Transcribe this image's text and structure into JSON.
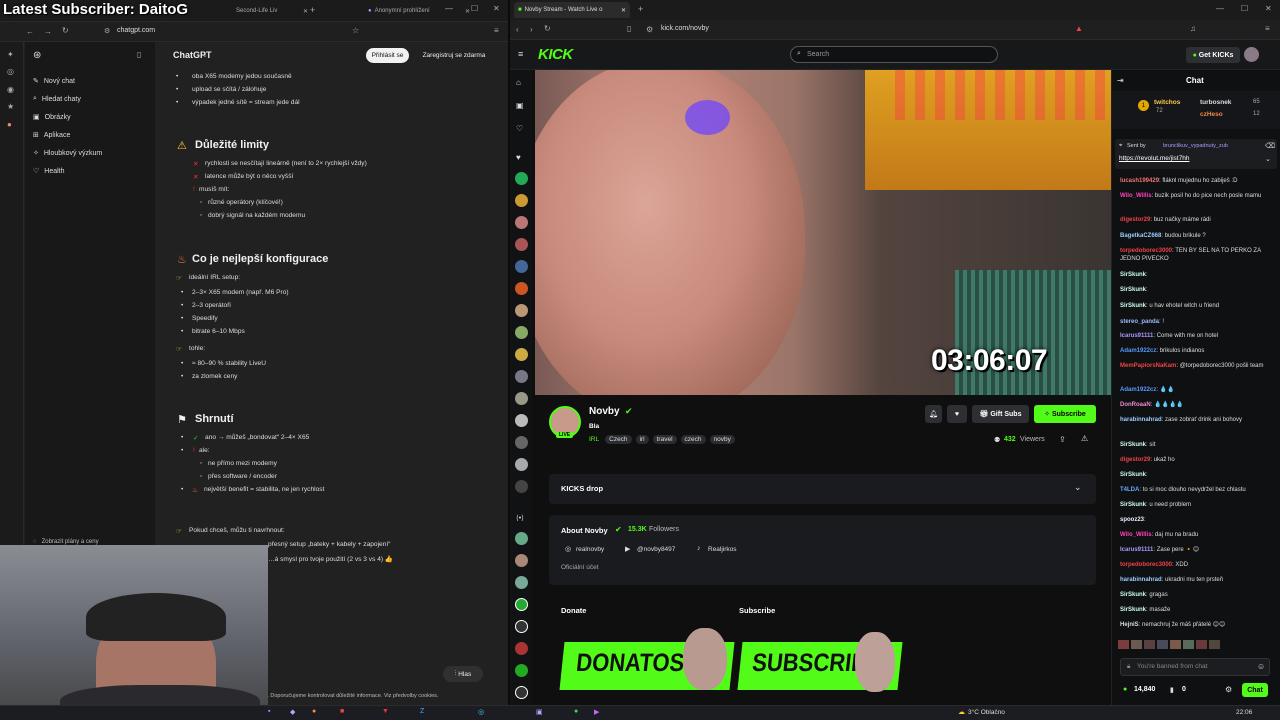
{
  "overlay": {
    "title": "Latest Subscriber: DaitoG"
  },
  "left_browser": {
    "tabs": [
      {
        "label": "Second-Life Liv"
      },
      {
        "label": "Anonymní prohlížení"
      }
    ],
    "url": "chatgpt.com",
    "app_title": "ChatGPT",
    "login_button": "Přihlásit se",
    "signup_button": "Zaregistruj se zdarma",
    "nav": [
      {
        "label": "Nový chat",
        "icon": "new-chat-icon"
      },
      {
        "label": "Hledat chaty",
        "icon": "search-icon"
      },
      {
        "label": "Obrázky",
        "icon": "image-icon"
      },
      {
        "label": "Aplikace",
        "icon": "apps-icon"
      },
      {
        "label": "Hloubkový výzkum",
        "icon": "research-icon"
      },
      {
        "label": "Health",
        "icon": "heart-icon"
      }
    ],
    "plans_link": "Zobrazit plány a ceny",
    "content": {
      "top_bullets": [
        "oba X65 modemy jedou současně",
        "upload se sčítá / zálohuje",
        "výpadek jedné sítě = stream jede dál"
      ],
      "limits_heading": "Důležité limity",
      "limits": [
        "rychlosti se nesčítají lineárně (není to 2× rychlejší vždy)",
        "latence může být o něco vyšší",
        "musíš mít:"
      ],
      "limits_sub": [
        "různé operátory (klíčové!)",
        "dobrý signál na každém modemu"
      ],
      "config_heading": "Co je nejlepší konfigurace",
      "ideal_label": "ideální IRL setup:",
      "ideal_items": [
        "2–3× X65 modem (např. M6 Pro)",
        "2–3 operátoři",
        "Speedify",
        "bitrate 6–10 Mbps"
      ],
      "tohle_label": "tohle:",
      "tohle_items": [
        "≈ 80–90 % stability LiveU",
        "za zlomek ceny"
      ],
      "summary_heading": "Shrnutí",
      "summary_yes": "ano → můžeš „bondovat“ 2–4× X65",
      "summary_but": "ale:",
      "summary_sub": [
        "ne přímo mezi modemy",
        "přes software / encoder"
      ],
      "summary_benefit": "největší benefit = stabilita, ne jen rychlost",
      "offer": "Pokud chceš, můžu ti navrhnout:",
      "offer_items": [
        "přesný setup „bateky + kabely + zapojení“",
        "…á smysl pro tvoje použití (2 vs 3 vs 4) 👍"
      ]
    },
    "voice_button": "Hlas",
    "disclaimer": "y. Doporučujeme kontrolovat důležité informace. Viz předvolby cookies."
  },
  "right_browser": {
    "tab_label": "Novby Stream - Watch Live o",
    "url": "kick.com/novby",
    "search_placeholder": "Search",
    "get_kicks": "Get KICKs",
    "stream_timer": "03:06:07",
    "streamer": {
      "name": "Novby",
      "title": "Bla",
      "category": "IRL",
      "tags": [
        "Czech",
        "irl",
        "travel",
        "czech",
        "novby"
      ],
      "live_badge": "LIVE",
      "viewers": "432",
      "viewers_label": "Viewers"
    },
    "gift_subs": "Gift Subs",
    "subscribe": "Subscribe",
    "kicks_drop": "KICKS drop",
    "about": {
      "title": "About Novby",
      "followers": "15.3K",
      "followers_label": "Followers",
      "instagram": "realnovby",
      "youtube": "@novby8497",
      "tiktok": "Realjirkos",
      "official": "Oficiální účet"
    },
    "donate_label": "Donate",
    "subscribe_label": "Subscribe",
    "panel_donate_text": "DONATOSS",
    "panel_subscribe_text": "SUBSCRIBE"
  },
  "chat": {
    "title": "Chat",
    "leaderboard": [
      {
        "name": "twitchos",
        "value": "72"
      },
      {
        "name": "turbosnek",
        "value": "65"
      },
      {
        "name": "czHeso",
        "value": "12"
      }
    ],
    "pinned_by": "Sent by",
    "pinned_user": "brunclikuv_vypadnuty_zub",
    "pinned_link": "https://revolut.me/jist7hh",
    "messages": [
      {
        "user": "lucash199429",
        "text": "fláknl mujednu ho zabiješ :D",
        "color": "#e77"
      },
      {
        "user": "Wilo_Willis",
        "text": "buzik posil ho do pice nech posle mamu",
        "color": "#f4b"
      },
      {
        "user": "digestor29",
        "text": "buz načky máme rádi",
        "color": "#e44"
      },
      {
        "user": "BagetkaCZ668",
        "text": "budou brikule ?",
        "color": "#9cf"
      },
      {
        "user": "torpedoborec3000",
        "text": "TEN BY SEL NA TO PERKO ZA JEDNO PIVECKO",
        "color": "#e44"
      },
      {
        "user": "SirSkunk",
        "text": "",
        "color": "#cfe"
      },
      {
        "user": "SirSkunk",
        "text": "",
        "color": "#cfe"
      },
      {
        "user": "SirSkunk",
        "text": "u hav ehotel witch u friend",
        "color": "#cfe"
      },
      {
        "user": "stereo_panda",
        "text": "!",
        "color": "#9bf"
      },
      {
        "user": "Icarus91111",
        "text": "Come with me on hotel",
        "color": "#a9f"
      },
      {
        "user": "Adam1922cz",
        "text": "brikulos indianos",
        "color": "#59f"
      },
      {
        "user": "MemPapiorsNaKam",
        "text": "@torpedoborec3000 pošli team",
        "color": "#e44"
      },
      {
        "user": "Adam1922cz",
        "text": "💧💧",
        "color": "#59f"
      },
      {
        "user": "DonRoaaN",
        "text": "💧💧💧💧",
        "color": "#e8c"
      },
      {
        "user": "harabinnahrad",
        "text": "zase zobrať drink ani bohovy",
        "color": "#9cf"
      },
      {
        "user": "SirSkunk",
        "text": "sit",
        "color": "#cfe"
      },
      {
        "user": "digestor29",
        "text": "ukaž ho",
        "color": "#e44"
      },
      {
        "user": "SirSkunk",
        "text": "",
        "color": "#cfe"
      },
      {
        "user": "T4LDA",
        "text": "to si moc dlouho nevydržel bez chlastu",
        "color": "#6af"
      },
      {
        "user": "SirSkunk",
        "text": "u need problem",
        "color": "#cfe"
      },
      {
        "user": "spooz23",
        "text": "",
        "color": "#eef"
      },
      {
        "user": "Wilo_Willis",
        "text": "daj mu na bradu",
        "color": "#f4b"
      },
      {
        "user": "Icarus91111",
        "text": "Zase pere 🔸😊",
        "color": "#a9f"
      },
      {
        "user": "torpedoborec3000",
        "text": "XDD",
        "color": "#e44"
      },
      {
        "user": "harabinnahrad",
        "text": "ukradni mu ten prsteň",
        "color": "#9cf"
      },
      {
        "user": "SirSkunk",
        "text": "gragas",
        "color": "#cfe"
      },
      {
        "user": "SirSkunk",
        "text": "masaže",
        "color": "#cfe"
      },
      {
        "user": "HejniS",
        "text": "nemachruj že máš přátelé 😊😊",
        "color": "#ddd"
      }
    ],
    "banned_placeholder": "You're banned from chat",
    "kicks_count": "14,840",
    "points": "0",
    "chat_button": "Chat"
  },
  "taskbar": {
    "weather": "3°C Oblačno",
    "time": "22:06"
  },
  "colors": {
    "kick_green": "#53fc18",
    "bg": "#0f0f10"
  }
}
